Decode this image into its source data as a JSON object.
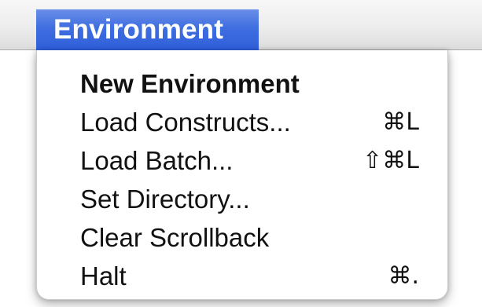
{
  "menubar": {
    "menu_title": "Environment"
  },
  "menu": {
    "items": [
      {
        "label": "New Environment",
        "shortcut": "",
        "bold": true
      },
      {
        "label": "Load Constructs...",
        "shortcut": "⌘L",
        "bold": false
      },
      {
        "label": "Load Batch...",
        "shortcut": "⇧⌘L",
        "bold": false
      },
      {
        "label": "Set Directory...",
        "shortcut": "",
        "bold": false
      },
      {
        "label": "Clear Scrollback",
        "shortcut": "",
        "bold": false
      },
      {
        "label": "Halt",
        "shortcut": "⌘.",
        "bold": false
      }
    ]
  },
  "colors": {
    "highlight": "#3f6ee0",
    "menubar_background": "#ededed",
    "menu_text": "#111111"
  }
}
